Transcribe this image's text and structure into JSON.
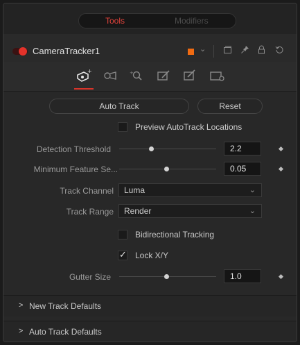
{
  "top_tabs": {
    "tools": "Tools",
    "modifiers": "Modifiers"
  },
  "header": {
    "node_name": "CameraTracker1",
    "node_color": "#f06b12",
    "icons": [
      "version-icon",
      "pin-icon",
      "lock-icon",
      "reset-icon"
    ]
  },
  "tabs": [
    {
      "name": "track-tab",
      "active": true
    },
    {
      "name": "camera-tab",
      "active": false
    },
    {
      "name": "solve-tab",
      "active": false
    },
    {
      "name": "export-tab",
      "active": false
    },
    {
      "name": "edit-tab",
      "active": false
    },
    {
      "name": "settings-tab",
      "active": false
    }
  ],
  "buttons": {
    "auto_track": "Auto Track",
    "reset": "Reset"
  },
  "preview_autotrack": {
    "label": "Preview AutoTrack Locations",
    "checked": false
  },
  "detection_threshold": {
    "label": "Detection Threshold",
    "value": "2.2"
  },
  "min_feature": {
    "label": "Minimum Feature Se...",
    "value": "0.05"
  },
  "track_channel": {
    "label": "Track Channel",
    "value": "Luma"
  },
  "track_range": {
    "label": "Track Range",
    "value": "Render"
  },
  "bidirectional": {
    "label": "Bidirectional Tracking",
    "checked": false
  },
  "lock_xy": {
    "label": "Lock X/Y",
    "checked": true
  },
  "gutter_size": {
    "label": "Gutter Size",
    "value": "1.0"
  },
  "sections": [
    {
      "title": "New Track Defaults"
    },
    {
      "title": "Auto Track Defaults"
    }
  ]
}
